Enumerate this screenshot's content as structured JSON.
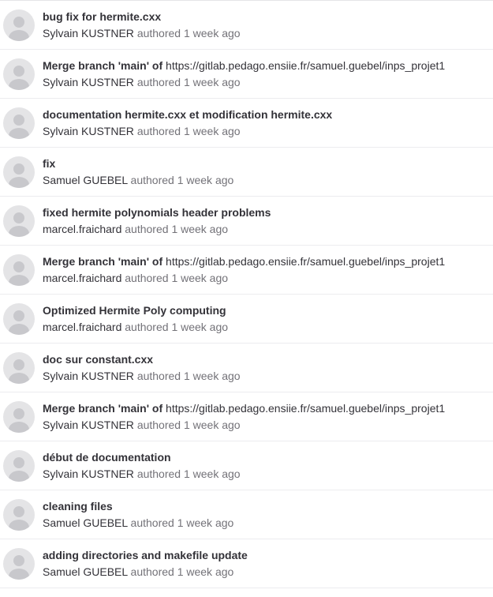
{
  "commits": [
    {
      "title": "bug fix for hermite.cxx",
      "link": "",
      "author": "Sylvain KUSTNER",
      "authored_label": "authored",
      "time": "1 week ago"
    },
    {
      "title": "Merge branch 'main' of",
      "link": "https://gitlab.pedago.ensiie.fr/samuel.guebel/inps_projet1",
      "author": "Sylvain KUSTNER",
      "authored_label": "authored",
      "time": "1 week ago"
    },
    {
      "title": "documentation hermite.cxx et modification hermite.cxx",
      "link": "",
      "author": "Sylvain KUSTNER",
      "authored_label": "authored",
      "time": "1 week ago"
    },
    {
      "title": "fix",
      "link": "",
      "author": "Samuel GUEBEL",
      "authored_label": "authored",
      "time": "1 week ago"
    },
    {
      "title": "fixed hermite polynomials header problems",
      "link": "",
      "author": "marcel.fraichard",
      "authored_label": "authored",
      "time": "1 week ago"
    },
    {
      "title": "Merge branch 'main' of",
      "link": "https://gitlab.pedago.ensiie.fr/samuel.guebel/inps_projet1",
      "author": "marcel.fraichard",
      "authored_label": "authored",
      "time": "1 week ago"
    },
    {
      "title": "Optimized Hermite Poly computing",
      "link": "",
      "author": "marcel.fraichard",
      "authored_label": "authored",
      "time": "1 week ago"
    },
    {
      "title": "doc sur constant.cxx",
      "link": "",
      "author": "Sylvain KUSTNER",
      "authored_label": "authored",
      "time": "1 week ago"
    },
    {
      "title": "Merge branch 'main' of",
      "link": "https://gitlab.pedago.ensiie.fr/samuel.guebel/inps_projet1",
      "author": "Sylvain KUSTNER",
      "authored_label": "authored",
      "time": "1 week ago"
    },
    {
      "title": "début de documentation",
      "link": "",
      "author": "Sylvain KUSTNER",
      "authored_label": "authored",
      "time": "1 week ago"
    },
    {
      "title": "cleaning files",
      "link": "",
      "author": "Samuel GUEBEL",
      "authored_label": "authored",
      "time": "1 week ago"
    },
    {
      "title": "adding directories and makefile update",
      "link": "",
      "author": "Samuel GUEBEL",
      "authored_label": "authored",
      "time": "1 week ago"
    }
  ],
  "colors": {
    "avatar_bg": "#e4e4e6",
    "avatar_fg": "#c8c8cc",
    "text_primary": "#333238",
    "text_secondary": "#737278",
    "divider": "#ececef"
  },
  "icons": {
    "avatar": "default-user-avatar-icon"
  }
}
